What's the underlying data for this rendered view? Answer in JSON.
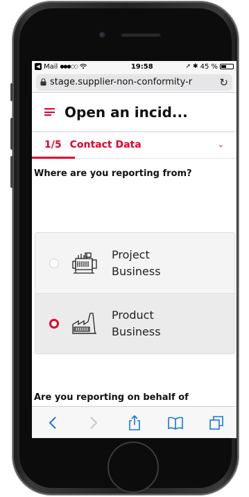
{
  "status_bar": {
    "carrier": "Mail",
    "signal": "●●●○○",
    "time": "19:58",
    "battery_text": "45 %",
    "battery_level": 0.45
  },
  "browser": {
    "url": "stage.supplier-non-conformity-r",
    "reload_icon": "reload-icon",
    "lock_icon": "lock-icon"
  },
  "header": {
    "title": "Open an incid..."
  },
  "step": {
    "number": "1/5",
    "label": "Contact Data"
  },
  "form": {
    "question": "Where are you reporting from?",
    "options": [
      {
        "label": "Project Business",
        "selected": false,
        "icon": "factory-machine-icon"
      },
      {
        "label": "Product Business",
        "selected": true,
        "icon": "factory-icon"
      }
    ],
    "next_question": "Are you reporting on behalf of"
  },
  "toolbar": {
    "items": [
      "back-icon",
      "forward-icon",
      "share-icon",
      "bookmarks-icon",
      "tabs-icon"
    ]
  },
  "colors": {
    "accent": "#e4002b",
    "ios_blue": "#1a73e8"
  }
}
